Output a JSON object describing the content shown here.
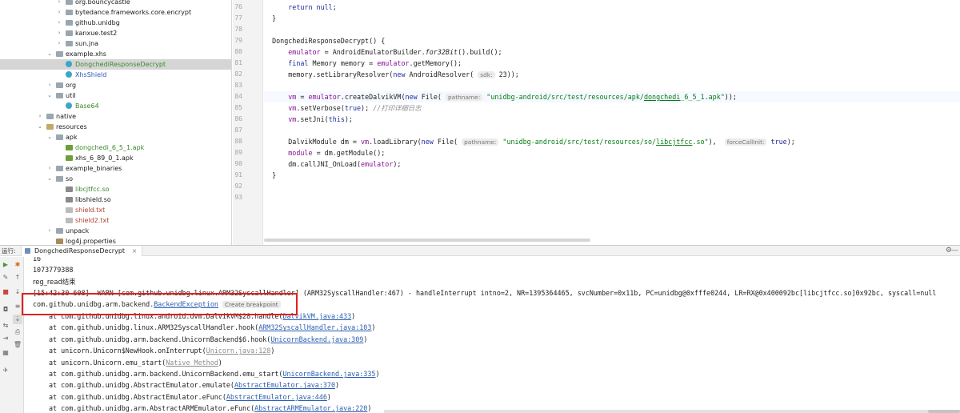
{
  "project_tree": {
    "items": [
      {
        "label": "org.bouncycastle",
        "indent": 2,
        "icon": "folder",
        "arrow": "›",
        "color": ""
      },
      {
        "label": "bytedance.frameworks.core.encrypt",
        "indent": 2,
        "icon": "folder",
        "arrow": "›",
        "color": ""
      },
      {
        "label": "github.unidbg",
        "indent": 2,
        "icon": "folder",
        "arrow": "›",
        "color": ""
      },
      {
        "label": "kanxue.test2",
        "indent": 2,
        "icon": "folder",
        "arrow": "›",
        "color": ""
      },
      {
        "label": "sun.jna",
        "indent": 2,
        "icon": "folder",
        "arrow": "›",
        "color": ""
      },
      {
        "label": "example.xhs",
        "indent": 1,
        "icon": "folder",
        "arrow": "⌄",
        "color": ""
      },
      {
        "label": "DongchediResponseDecrypt",
        "indent": 2,
        "icon": "class",
        "arrow": "",
        "color": "green"
      },
      {
        "label": "XhsShield",
        "indent": 2,
        "icon": "class",
        "arrow": "",
        "color": "blue"
      },
      {
        "label": "org",
        "indent": 1,
        "icon": "folder",
        "arrow": "›",
        "color": ""
      },
      {
        "label": "util",
        "indent": 1,
        "icon": "folder",
        "arrow": "⌄",
        "color": ""
      },
      {
        "label": "Base64",
        "indent": 2,
        "icon": "class",
        "arrow": "",
        "color": "green"
      },
      {
        "label": "native",
        "indent": 0,
        "icon": "folder",
        "arrow": "›",
        "color": ""
      },
      {
        "label": "resources",
        "indent": 0,
        "icon": "folder-res",
        "arrow": "⌄",
        "color": ""
      },
      {
        "label": "apk",
        "indent": 1,
        "icon": "folder",
        "arrow": "⌄",
        "color": ""
      },
      {
        "label": "dongchedi_6_5_1.apk",
        "indent": 2,
        "icon": "apk",
        "arrow": "",
        "color": "green"
      },
      {
        "label": "xhs_6_89_0_1.apk",
        "indent": 2,
        "icon": "apk",
        "arrow": "",
        "color": ""
      },
      {
        "label": "example_binaries",
        "indent": 1,
        "icon": "folder",
        "arrow": "›",
        "color": ""
      },
      {
        "label": "so",
        "indent": 1,
        "icon": "folder",
        "arrow": "⌄",
        "color": ""
      },
      {
        "label": "libcjtfcc.so",
        "indent": 2,
        "icon": "so",
        "arrow": "",
        "color": "green"
      },
      {
        "label": "libshield.so",
        "indent": 2,
        "icon": "so",
        "arrow": "",
        "color": ""
      },
      {
        "label": "shield.txt",
        "indent": 2,
        "icon": "txt",
        "arrow": "",
        "color": "red"
      },
      {
        "label": "shield2.txt",
        "indent": 2,
        "icon": "txt",
        "arrow": "",
        "color": "red"
      },
      {
        "label": "unpack",
        "indent": 1,
        "icon": "folder",
        "arrow": "›",
        "color": ""
      },
      {
        "label": "log4j.properties",
        "indent": 1,
        "icon": "prop",
        "arrow": "",
        "color": ""
      }
    ]
  },
  "editor": {
    "line_numbers": [
      "76",
      "77",
      "78",
      "79",
      "80",
      "81",
      "82",
      "83",
      "84",
      "85",
      "86",
      "87",
      "88",
      "89",
      "90",
      "91",
      "92",
      "93"
    ]
  },
  "run_panel": {
    "label": "运行:",
    "tab_title": "DongchediResponseDecrypt",
    "tab_close": "×",
    "settings_icon": "⚙",
    "minimize_icon": "—"
  },
  "console": {
    "line_0": "16",
    "line_1": "1073779388",
    "line_2": "reg_read结束",
    "line_3": "[15:42:30 608]  WARN [com.github.unidbg.linux.ARM32SyscallHandler] (ARM32SyscallHandler:467) - handleInterrupt intno=2, NR=1395364465, svcNumber=0x11b, PC=unidbg@0xfffe0244, LR=RX@0x400092bc[libcjtfcc.so]0x92bc, syscall=null",
    "exception_prefix": "com.github.unidbg.arm.backend.",
    "exception_link": "BackendException",
    "exception_tip": "Create breakpoint",
    "stack": [
      {
        "text": "at com.github.unidbg.linux.android.dvm.DalvikVM$28.handle(",
        "link": "DalvikVM.java:433",
        "end": ")"
      },
      {
        "text": "at com.github.unidbg.linux.ARM32SyscallHandler.hook(",
        "link": "ARM32SyscallHandler.java:103",
        "end": ")"
      },
      {
        "text": "at com.github.unidbg.arm.backend.UnicornBackend$6.hook(",
        "link": "UnicornBackend.java:309",
        "end": ")"
      },
      {
        "text": "at unicorn.Unicorn$NewHook.onInterrupt(",
        "link": "Unicorn.java:128",
        "end": ")",
        "gray": true
      },
      {
        "text": "at unicorn.Unicorn.emu_start(",
        "link": "Native Method",
        "end": ")",
        "gray": true
      },
      {
        "text": "at com.github.unidbg.arm.backend.UnicornBackend.emu_start(",
        "link": "UnicornBackend.java:335",
        "end": ")"
      },
      {
        "text": "at com.github.unidbg.AbstractEmulator.emulate(",
        "link": "AbstractEmulator.java:370",
        "end": ")"
      },
      {
        "text": "at com.github.unidbg.AbstractEmulator.eFunc(",
        "link": "AbstractEmulator.java:446",
        "end": ")"
      },
      {
        "text": "at com.github.unidbg.arm.AbstractARMEmulator.eFunc(",
        "link": "AbstractARMEmulator.java:220",
        "end": ")"
      }
    ]
  },
  "colors": {
    "highlight_box": "#e02020",
    "link": "#2a5db0",
    "keyword": "#1d2b9a",
    "field": "#871094",
    "string": "#067d17"
  }
}
